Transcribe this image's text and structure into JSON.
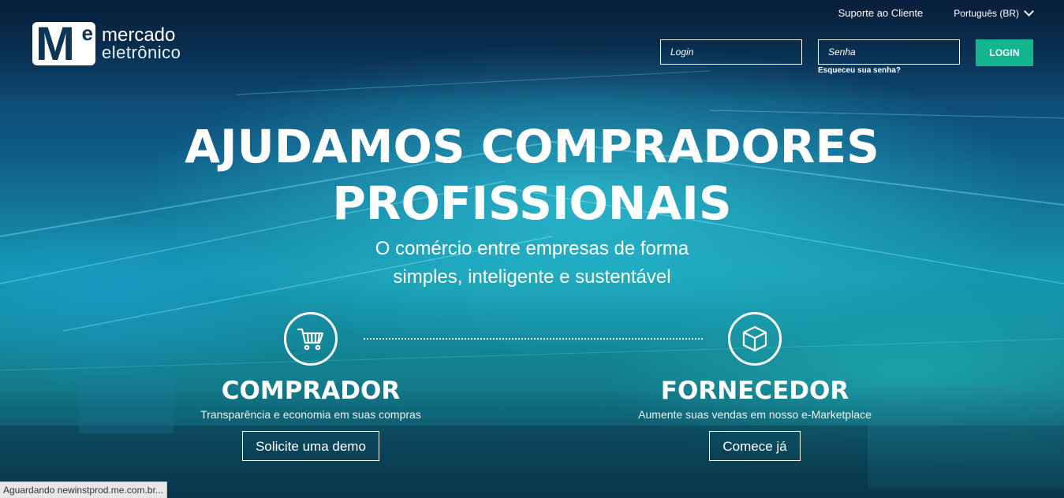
{
  "brand": {
    "name_line1": "mercado",
    "name_line2": "eletrônico",
    "mark_letter": "M",
    "mark_super": "e"
  },
  "header": {
    "support_link": "Suporte ao Cliente",
    "language": "Português (BR)",
    "login_placeholder": "Login",
    "password_placeholder": "Senha",
    "forgot_password": "Esqueceu sua senha?",
    "login_button": "LOGIN"
  },
  "hero": {
    "headline_line1": "AJUDAMOS COMPRADORES",
    "headline_line2": "PROFISSIONAIS",
    "subtitle_line1": "O comércio entre empresas de forma",
    "subtitle_line2": "simples, inteligente e sustentável"
  },
  "buyer": {
    "icon": "shopping-cart-icon",
    "title": "COMPRADOR",
    "description": "Transparência e economia em suas compras",
    "button": "Solicite uma demo"
  },
  "supplier": {
    "icon": "box-icon",
    "title": "FORNECEDOR",
    "description": "Aumente suas vendas em nosso e-Marketplace",
    "button": "Comece já"
  },
  "status_bar": {
    "text": "Aguardando newinstprod.me.com.br..."
  },
  "colors": {
    "accent_green": "#13b58f",
    "dark_navy": "#0d3556"
  }
}
